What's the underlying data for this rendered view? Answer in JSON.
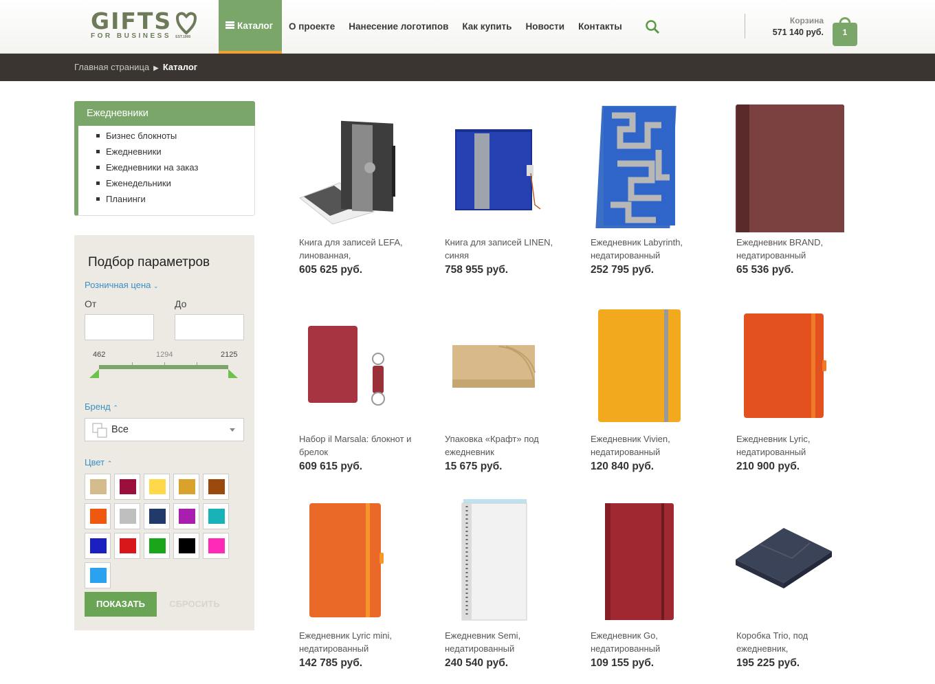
{
  "header": {
    "logo_text": "GIFTS",
    "logo_sub": "FOR BUSINESS",
    "logo_est": "EST.1998",
    "nav": [
      {
        "label": "Каталог"
      },
      {
        "label": "О проекте"
      },
      {
        "label": "Нанесение логотипов"
      },
      {
        "label": "Как купить"
      },
      {
        "label": "Новости"
      },
      {
        "label": "Контакты"
      }
    ],
    "search_icon": "search-icon",
    "cart": {
      "label": "Корзина",
      "sum": "571 140 руб.",
      "count": "1"
    }
  },
  "breadcrumb": {
    "home": "Главная страница",
    "current": "Каталог"
  },
  "sidebar": {
    "category_title": "Ежедневники",
    "items": [
      "Бизнес блокноты",
      "Ежедневники",
      "Ежедневники на заказ",
      "Еженедельники",
      "Планинги"
    ]
  },
  "filter": {
    "title": "Подбор параметров",
    "price_label": "Розничная цена",
    "from_label": "От",
    "to_label": "До",
    "from_value": "",
    "to_value": "",
    "scale": [
      "462",
      "1294",
      "2125"
    ],
    "brand_label": "Бренд",
    "brand_value": "Все",
    "color_label": "Цвет",
    "colors": [
      "#d4bc8c",
      "#9b0f3c",
      "#ffd94a",
      "#d8a22c",
      "#9a4a0c",
      "#f0570f",
      "#bfbfbf",
      "#223a6a",
      "#a81fb0",
      "#17b3b8",
      "#1c1fc0",
      "#d8171b",
      "#1aa61a",
      "#000000",
      "#ff2bb8",
      "#2aa2f0"
    ],
    "show_button": "ПОКАЗАТЬ",
    "reset_button": "СБРОСИТЬ"
  },
  "products": [
    {
      "title": "Книга для записей LEFA, линованная,",
      "price": "605 625 руб."
    },
    {
      "title": "Книга для записей LINEN, синяя",
      "price": "758 955 руб."
    },
    {
      "title": "Ежедневник Labyrinth, недатированный",
      "price": "252 795 руб."
    },
    {
      "title": "Ежедневник BRAND, недатированный",
      "price": "65 536 руб."
    },
    {
      "title": "Набор il Marsala: блокнот и брелок",
      "price": "609 615 руб."
    },
    {
      "title": "Упаковка «Крафт» под ежедневник",
      "price": "15 675 руб."
    },
    {
      "title": "Ежедневник Vivien, недатированный",
      "price": "120 840 руб."
    },
    {
      "title": "Ежедневник Lyric, недатированный",
      "price": "210 900 руб."
    },
    {
      "title": "Ежедневник Lyric mini, недатированный",
      "price": "142 785 руб."
    },
    {
      "title": "Ежедневник Semi, недатированный",
      "price": "240 540 руб."
    },
    {
      "title": "Ежедневник Go, недатированный",
      "price": "109 155 руб."
    },
    {
      "title": "Коробка Trio, под ежедневник,",
      "price": "195 225 руб."
    }
  ]
}
